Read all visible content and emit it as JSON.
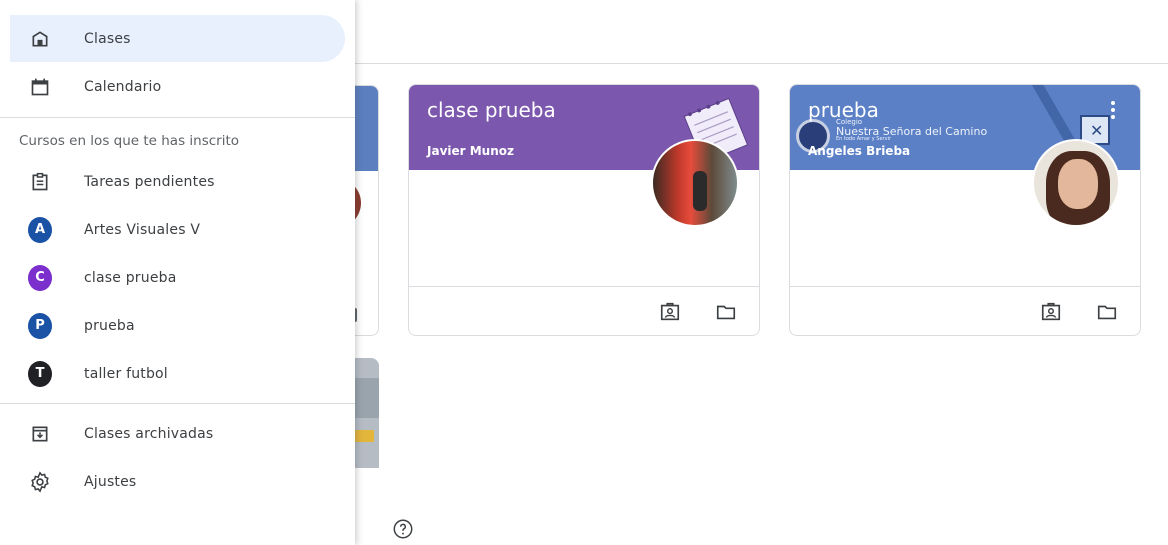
{
  "drawer": {
    "items_top": [
      {
        "label": "Clases",
        "icon": "home-icon",
        "active": true
      },
      {
        "label": "Calendario",
        "icon": "calendar-icon",
        "active": false
      }
    ],
    "section_title": "Cursos en los que te has inscrito",
    "todo": {
      "label": "Tareas pendientes",
      "icon": "assignment-icon"
    },
    "courses": [
      {
        "letter": "A",
        "label": "Artes Visuales V",
        "color": "#1a52a5"
      },
      {
        "letter": "C",
        "label": "clase prueba",
        "color": "#7b2fcc"
      },
      {
        "letter": "P",
        "label": "prueba",
        "color": "#1a52a5"
      },
      {
        "letter": "T",
        "label": "taller futbol",
        "color": "#202124"
      }
    ],
    "items_bottom": [
      {
        "label": "Clases archivadas",
        "icon": "archive-icon"
      },
      {
        "label": "Ajustes",
        "icon": "settings-icon"
      }
    ]
  },
  "cards": [
    {
      "title": "clase prueba",
      "teacher": "Javier Munoz",
      "color": "#7b58ad"
    },
    {
      "title": "prueba",
      "teacher": "Angeles Brieba",
      "color": "#5b80c6",
      "school_line1": "Colegio",
      "school_line2": "Nuestra Señora del Camino",
      "school_line3": "En todo Amar y Servir"
    }
  ]
}
